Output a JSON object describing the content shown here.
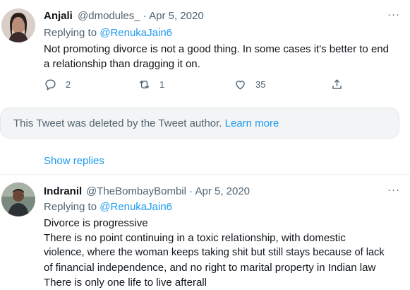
{
  "tweet1": {
    "name": "Anjali",
    "handle": "@dmodules_",
    "date": "Apr 5, 2020",
    "separator": "·",
    "more": "···",
    "replying_prefix": "Replying to",
    "replying_to": "@RenukaJain6",
    "text": "Not promoting divorce is not a good thing. In some cases it's better to end a relationship than dragging it on.",
    "actions": {
      "reply_count": "2",
      "retweet_count": "1",
      "like_count": "35"
    }
  },
  "deleted": {
    "text": "This Tweet was deleted by the Tweet author.",
    "link": "Learn more"
  },
  "show_replies": "Show replies",
  "tweet2": {
    "name": "Indranil",
    "handle": "@TheBombayBombil",
    "date": "Apr 5, 2020",
    "separator": "·",
    "more": "···",
    "replying_prefix": "Replying to",
    "replying_to": "@RenukaJain6",
    "lines": [
      "Divorce is progressive",
      "There is no point continuing in a toxic relationship, with domestic",
      "violence, where the woman keeps taking shit but still stays because of lack",
      "of financial independence, and no right to marital property in Indian law",
      "There is only one life to live afterall"
    ]
  },
  "colors": {
    "accent": "#1d9bf0",
    "secondary_text": "#536471",
    "deleted_bg": "#f2f4f5"
  }
}
